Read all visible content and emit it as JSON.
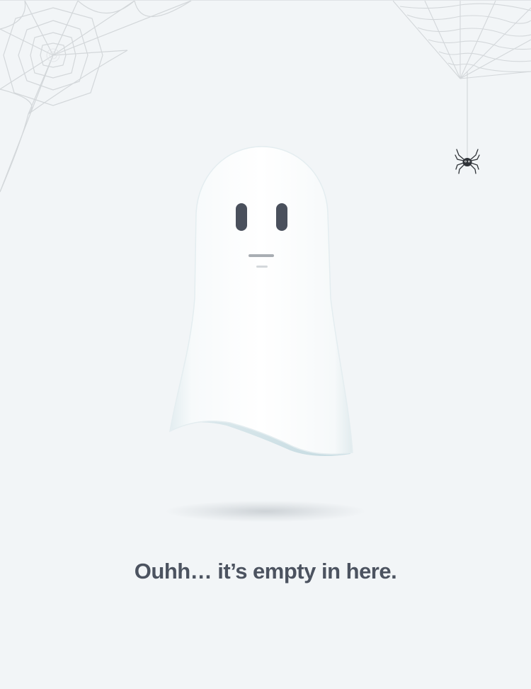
{
  "empty_state": {
    "title": "Ouhh… it’s empty in here.",
    "subtitle": ""
  },
  "colors": {
    "background": "#f2f5f7",
    "title": "#4c5360",
    "ghost_body": "#ffffff",
    "ghost_eyes": "#4a505c",
    "cobweb": "#d3d7da",
    "spider": "#2f3338"
  },
  "icons": {
    "ghost": "ghost-illustration",
    "spider": "spider-icon",
    "cobweb_left": "cobweb-icon",
    "cobweb_right": "cobweb-icon"
  }
}
